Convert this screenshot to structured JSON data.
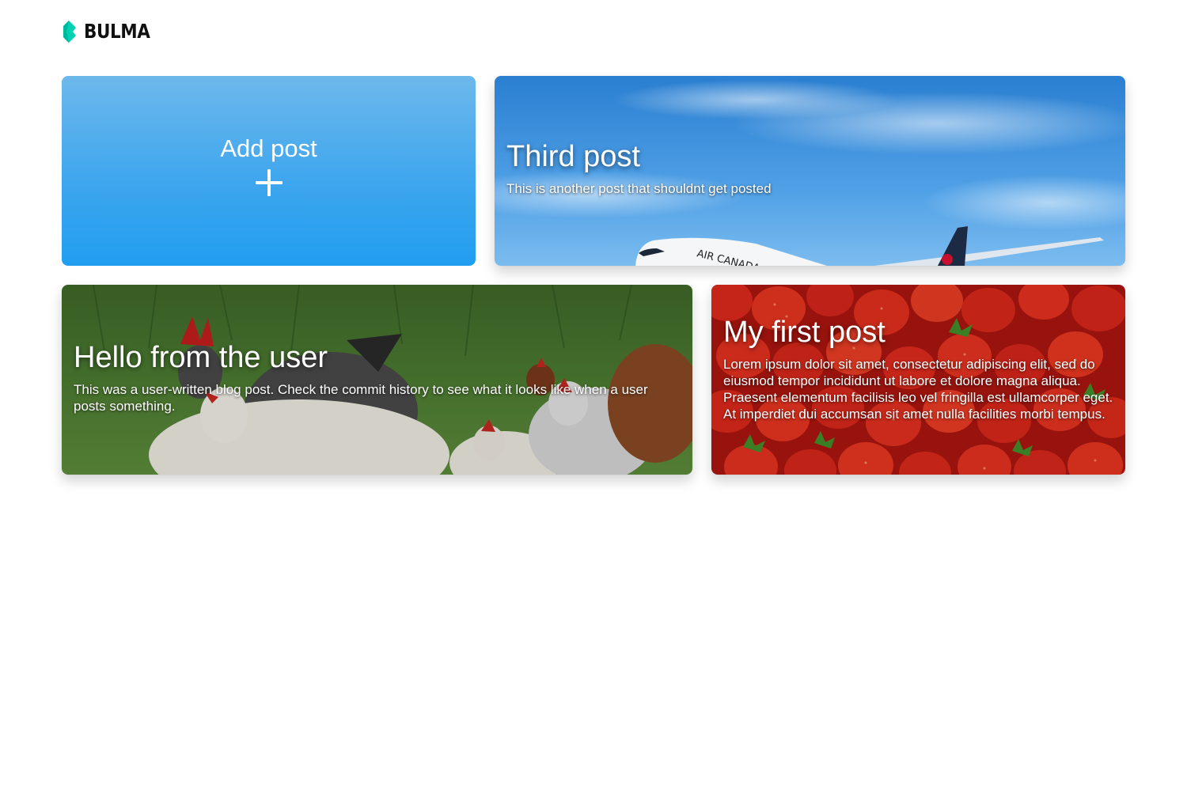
{
  "navbar": {
    "brand": "BULMA",
    "brand_color": "#00d1b2",
    "logo_icon": "bulma-logo-icon"
  },
  "add_post": {
    "label": "Add post",
    "icon": "plus-icon"
  },
  "posts": [
    {
      "title": "Third post",
      "description": "This is another post that shouldnt get posted",
      "image": "airplane-sky-photo",
      "image_text": "AIR CANADA"
    },
    {
      "title": "Hello from the user",
      "description": "This was a user-written blog post. Check the commit history to see what it looks like when a user posts something.",
      "image": "chickens-grass-photo"
    },
    {
      "title": "My first post",
      "description": "Lorem ipsum dolor sit amet, consectetur adipiscing elit, sed do eiusmod tempor incididunt ut labore et dolore magna aliqua. Praesent elementum facilisis leo vel fringilla est ullamcorper eget. At imperdiet dui accumsan sit amet nulla facilities morbi tempus.",
      "image": "strawberries-photo"
    }
  ],
  "colors": {
    "add_card_top": "#6db8eb",
    "add_card_bottom": "#219ef0"
  }
}
